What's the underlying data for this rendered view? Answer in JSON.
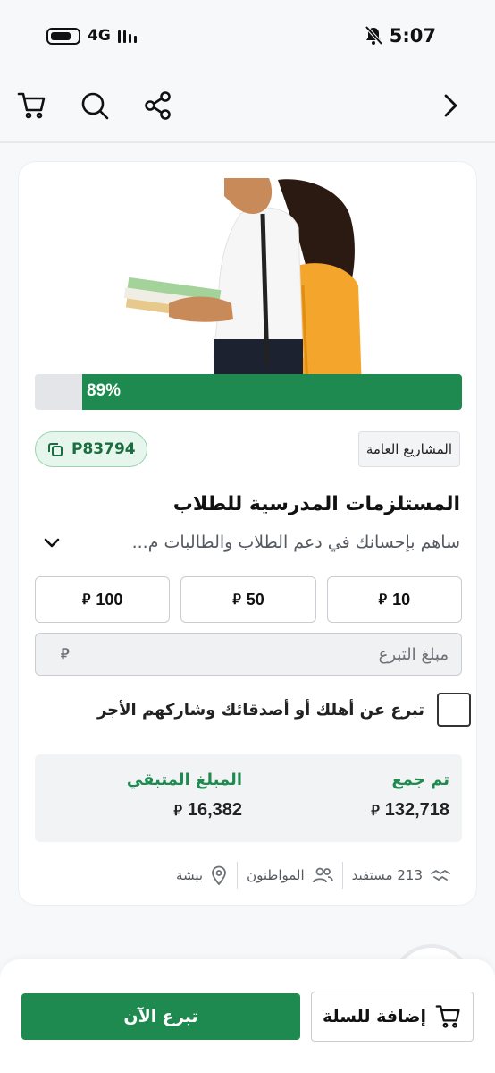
{
  "status_bar": {
    "network": "4G",
    "time": "5:07"
  },
  "toolbar": {
    "cart_icon": "cart-icon",
    "search_icon": "search-icon",
    "share_icon": "share-icon",
    "back_icon": "chevron-right-icon"
  },
  "project": {
    "progress_percent": 89,
    "progress_label": "89%",
    "code": "P83794",
    "category": "المشاريع العامة",
    "title": "المستلزمات المدرسية للطلاب",
    "description": "ساهم بإحسانك في دعم الطلاب والطالبات م..."
  },
  "amounts": [
    {
      "value": "10"
    },
    {
      "value": "50"
    },
    {
      "value": "100"
    }
  ],
  "currency_symbol": "⃁",
  "donation_input": {
    "placeholder": "مبلغ التبرع"
  },
  "gift": {
    "label": "تبرع عن أهلك أو أصدقائك وشاركهم الأجر"
  },
  "stats": {
    "collected_label": "تم جمع",
    "collected_value": "132,718",
    "remaining_label": "المبلغ المتبقي",
    "remaining_value": "16,382"
  },
  "meta": {
    "beneficiaries": "213 مستفيد",
    "audience": "المواطنون",
    "location": "بيشة"
  },
  "actions": {
    "donate_now": "تبرع الآن",
    "add_to_cart": "إضافة للسلة"
  },
  "colors": {
    "brand_green": "#1f8a50",
    "badge_bg": "#e7f6ec"
  }
}
